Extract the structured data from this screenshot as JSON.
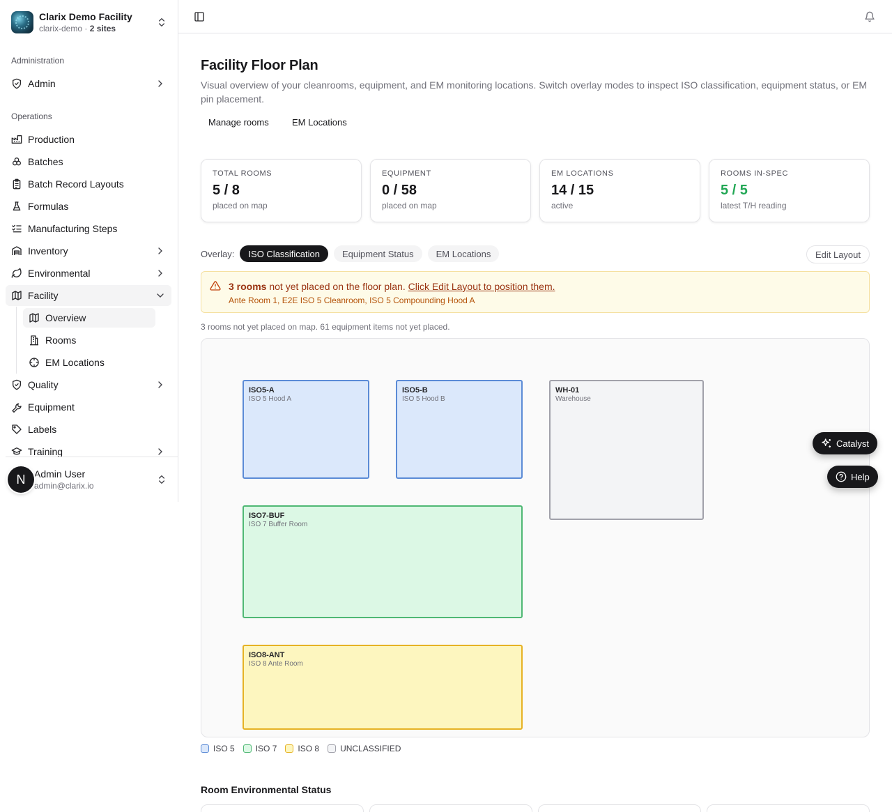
{
  "org": {
    "name": "Clarix Demo Facility",
    "slug": "clarix-demo",
    "sites_sep": " · ",
    "sites": "2 sites"
  },
  "sidebar": {
    "groups": {
      "administration": "Administration",
      "operations": "Operations"
    },
    "items": {
      "admin": "Admin",
      "production": "Production",
      "batches": "Batches",
      "batch_record_layouts": "Batch Record Layouts",
      "formulas": "Formulas",
      "manufacturing_steps": "Manufacturing Steps",
      "inventory": "Inventory",
      "environmental": "Environmental",
      "facility": "Facility",
      "quality": "Quality",
      "equipment": "Equipment",
      "labels": "Labels",
      "training": "Training"
    },
    "facility_sub": {
      "overview": "Overview",
      "rooms": "Rooms",
      "em_locations": "EM Locations"
    }
  },
  "user": {
    "initial": "N",
    "name": "Admin User",
    "email": "admin@clarix.io"
  },
  "page": {
    "title": "Facility Floor Plan",
    "description": "Visual overview of your cleanrooms, equipment, and EM monitoring locations. Switch overlay modes to inspect ISO classification, equipment status, or EM pin placement.",
    "actions": {
      "manage_rooms": "Manage rooms",
      "em_locations": "EM Locations"
    }
  },
  "stats": [
    {
      "label": "TOTAL ROOMS",
      "value": "5 / 8",
      "sub": "placed on map"
    },
    {
      "label": "EQUIPMENT",
      "value": "0 / 58",
      "sub": "placed on map"
    },
    {
      "label": "EM LOCATIONS",
      "value": "14 / 15",
      "sub": "active"
    },
    {
      "label": "ROOMS IN-SPEC",
      "value": "5 / 5",
      "sub": "latest T/H reading",
      "color": "#22a755"
    }
  ],
  "overlay": {
    "label": "Overlay:",
    "modes": [
      "ISO Classification",
      "Equipment Status",
      "EM Locations"
    ],
    "active": "ISO Classification",
    "edit_layout": "Edit Layout"
  },
  "alert": {
    "count_text": "3 rooms",
    "text": " not yet placed on the floor plan. ",
    "link": "Click Edit Layout to position them.",
    "rooms": "Ante Room 1, E2E ISO 5 Cleanroom, ISO 5 Compounding Hood A"
  },
  "not_placed_note": "3 rooms not yet placed on map. 61 equipment items not yet placed.",
  "rooms": [
    {
      "code": "ISO5-A",
      "name": "ISO 5 Hood A",
      "class": "iso5"
    },
    {
      "code": "ISO5-B",
      "name": "ISO 5 Hood B",
      "class": "iso5"
    },
    {
      "code": "WH-01",
      "name": "Warehouse",
      "class": "uncl"
    },
    {
      "code": "ISO7-BUF",
      "name": "ISO 7 Buffer Room",
      "class": "iso7"
    },
    {
      "code": "ISO8-ANT",
      "name": "ISO 8 Ante Room",
      "class": "iso8"
    }
  ],
  "legend": [
    {
      "label": "ISO 5",
      "color": "#5b8bd6",
      "fill": "#dbe8fb"
    },
    {
      "label": "ISO 7",
      "color": "#4fb874",
      "fill": "#dcf8e5"
    },
    {
      "label": "ISO 8",
      "color": "#e6b224",
      "fill": "#fdf6bf"
    },
    {
      "label": "UNCLASSIFIED",
      "color": "#a1a1aa",
      "fill": "#f3f4f6"
    }
  ],
  "env_section_title": "Room Environmental Status",
  "floating": {
    "catalyst": "Catalyst",
    "help": "Help"
  }
}
